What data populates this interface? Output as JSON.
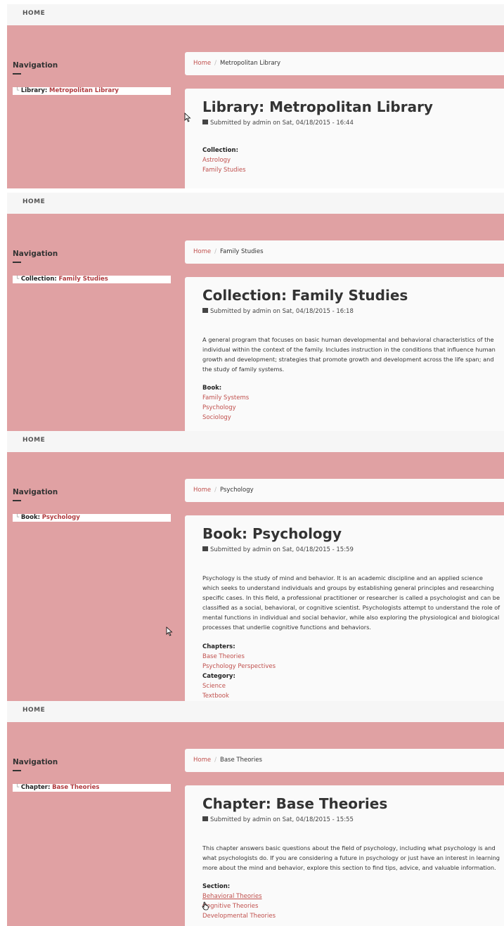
{
  "topbar": {
    "home": "HOME"
  },
  "sidebar": {
    "title": "Navigation"
  },
  "crumb": {
    "home": "Home",
    "separator": "/"
  },
  "meta": {
    "submitted_prefix": "Submitted by admin on"
  },
  "panels": [
    {
      "crumb_current": "Metropolitan Library",
      "nav_kind": "Library:",
      "nav_name": "Metropolitan Library",
      "title": "Library: Metropolitan Library",
      "date": "Sat, 04/18/2015 - 16:44",
      "fields": [
        {
          "label": "Collection:",
          "links": [
            "Astrology",
            "Family Studies"
          ]
        }
      ]
    },
    {
      "crumb_current": "Family Studies",
      "nav_kind": "Collection:",
      "nav_name": "Family Studies",
      "title": "Collection: Family Studies",
      "date": "Sat, 04/18/2015 - 16:18",
      "description": "A general program that focuses on basic human developmental and behavioral characteristics of the individual within the context of the family. Includes instruction in the conditions that influence human growth and development; strategies that promote growth and development across the life span; and the study of family systems.",
      "fields": [
        {
          "label": "Book:",
          "links": [
            "Family Systems",
            "Psychology",
            "Sociology"
          ]
        }
      ]
    },
    {
      "crumb_current": "Psychology",
      "nav_kind": "Book:",
      "nav_name": "Psychology",
      "title": "Book: Psychology",
      "date": "Sat, 04/18/2015 - 15:59",
      "description": "Psychology is the study of mind and behavior. It is an academic discipline and an applied science which seeks to understand individuals and groups by establishing general principles and researching specific cases. In this field, a professional practitioner or researcher is called a psychologist and can be classified as a social, behavioral, or cognitive scientist. Psychologists attempt to understand the role of mental functions in individual and social behavior, while also exploring the physiological and biological processes that underlie cognitive functions and behaviors.",
      "fields": [
        {
          "label": "Chapters:",
          "links": [
            "Base Theories",
            "Psychology Perspectives"
          ]
        },
        {
          "label": "Category:",
          "links": [
            "Science",
            "Textbook"
          ]
        }
      ]
    },
    {
      "crumb_current": "Base Theories",
      "nav_kind": "Chapter:",
      "nav_name": "Base Theories",
      "title": "Chapter: Base Theories",
      "date": "Sat, 04/18/2015 - 15:55",
      "description": "This chapter answers basic questions about the field of psychology, including what psychology is and what psychologists do. If you are considering a future in psychology or just have an interest in learning more about the mind and behavior, explore this section to find tips, advice, and valuable information.",
      "fields": [
        {
          "label": "Section:",
          "links": [
            "Behavioral Theories",
            "Cognitive Theories",
            "Developmental Theories"
          ]
        }
      ]
    }
  ]
}
